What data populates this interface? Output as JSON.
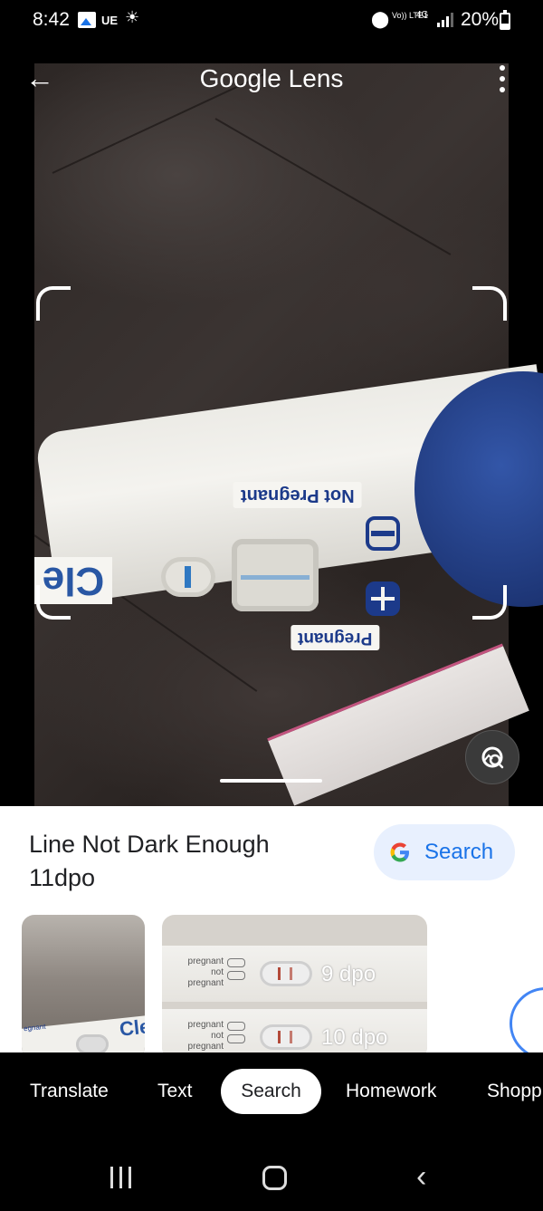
{
  "status_bar": {
    "time": "8:42",
    "carrier_label": "UE",
    "volte_label": "Vo)) LTE1",
    "network_label": "4G",
    "battery": "20%"
  },
  "app": {
    "title_google": "Google",
    "title_lens": "Lens"
  },
  "photo": {
    "label_not_pregnant": "Not Pregnant",
    "label_pregnant": "Pregnant",
    "brand_text": "Cle"
  },
  "result": {
    "title": "Line Not Dark Enough 11dpo",
    "search_button_label": "Search"
  },
  "thumbnails": [
    {
      "caption_pregnant": "egnant",
      "brand": "Cle"
    },
    {
      "rows": [
        {
          "pregnant": "pregnant",
          "not_pregnant": "not pregnant",
          "dpo": "9 dpo"
        },
        {
          "pregnant": "pregnant",
          "not_pregnant": "not pregnant",
          "dpo": "10 dpo"
        }
      ]
    }
  ],
  "tabs": [
    {
      "label": "Translate"
    },
    {
      "label": "Text"
    },
    {
      "label": "Search",
      "selected": true
    },
    {
      "label": "Homework"
    },
    {
      "label": "Shopp"
    }
  ],
  "colors": {
    "accent_blue": "#1a73e8",
    "search_pill_bg": "#e8f0fe",
    "test_blue": "#1c3a8a"
  },
  "icons": {
    "back": "arrow-left-icon",
    "menu": "more-vert-icon",
    "lens_search": "image-search-icon",
    "google": "google-g-icon"
  }
}
